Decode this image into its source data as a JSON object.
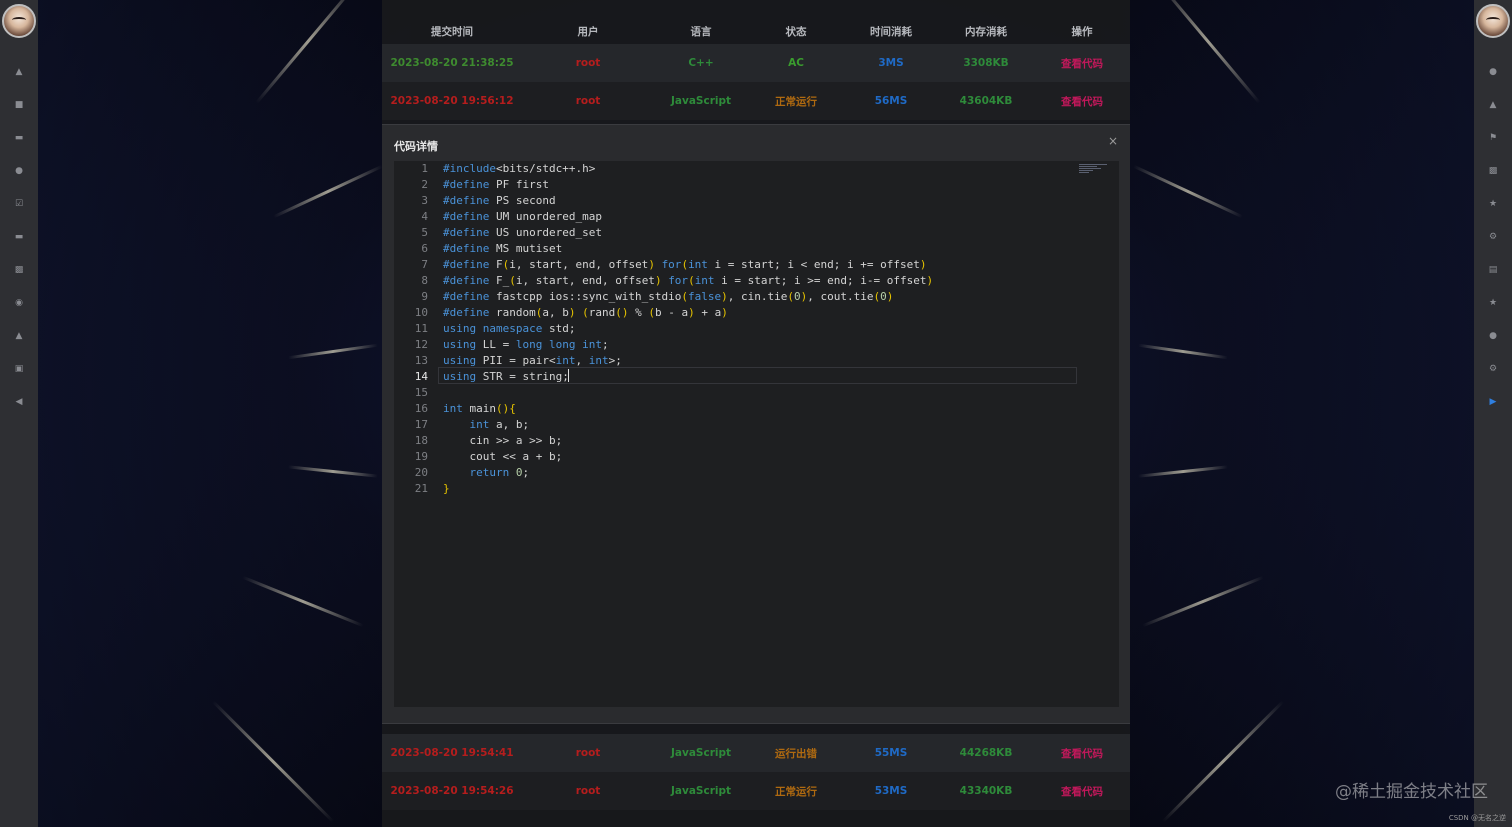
{
  "table": {
    "headers": [
      "提交时间",
      "用户",
      "语言",
      "状态",
      "时间消耗",
      "内存消耗",
      "操作"
    ],
    "rows": [
      {
        "time": "2023-08-20 21:38:25",
        "user": "root",
        "lang": "C++",
        "status": "AC",
        "runtime": "3MS",
        "memory": "3308KB",
        "action": "查看代码"
      },
      {
        "time": "2023-08-20 19:56:12",
        "user": "root",
        "lang": "JavaScript",
        "status": "正常运行",
        "runtime": "56MS",
        "memory": "43604KB",
        "action": "查看代码"
      },
      {
        "time": "2023-08-20 19:54:41",
        "user": "root",
        "lang": "JavaScript",
        "status": "运行出错",
        "runtime": "55MS",
        "memory": "44268KB",
        "action": "查看代码"
      },
      {
        "time": "2023-08-20 19:54:26",
        "user": "root",
        "lang": "JavaScript",
        "status": "正常运行",
        "runtime": "53MS",
        "memory": "43340KB",
        "action": "查看代码"
      }
    ]
  },
  "dialog": {
    "title": "代码详情",
    "close": "×",
    "cursor_line": 14,
    "code_lines": [
      "#include<bits/stdc++.h>",
      "#define PF first",
      "#define PS second",
      "#define UM unordered_map",
      "#define US unordered_set",
      "#define MS mutiset",
      "#define F(i, start, end, offset) for(int i = start; i < end; i += offset)",
      "#define F_(i, start, end, offset) for(int i = start; i >= end; i-= offset)",
      "#define fastcpp ios::sync_with_stdio(false), cin.tie(0), cout.tie(0)",
      "#define random(a, b) (rand() % (b - a) + a)",
      "using namespace std;",
      "using LL = long long int;",
      "using PII = pair<int, int>;",
      "using STR = string;",
      "",
      "int main(){",
      "    int a, b;",
      "    cin >> a >> b;",
      "    cout << a + b;",
      "    return 0;",
      "}"
    ]
  },
  "sidebar_left": {
    "icons": [
      "home-icon",
      "document-icon",
      "monitor-icon",
      "user-icon",
      "checklist-icon",
      "monitor-icon",
      "truck-icon",
      "location-pin-icon",
      "cloud-upload-icon",
      "chat-icon",
      "collapse-left-icon"
    ]
  },
  "sidebar_right": {
    "icons": [
      "user-icon",
      "bell-icon",
      "flag-icon",
      "truck-icon",
      "star-icon",
      "settings-icon",
      "clipboard-icon",
      "star-icon",
      "user-icon",
      "gear-icon",
      "expand-right-icon"
    ]
  },
  "watermark": "@稀土掘金技术社区",
  "credit": "CSDN @无名之逆",
  "colors": {
    "accept": "#3a9c2e",
    "error": "#b51d1d",
    "warning": "#b06a10",
    "link": "#c2185b",
    "runtime": "#1f6ac6"
  }
}
